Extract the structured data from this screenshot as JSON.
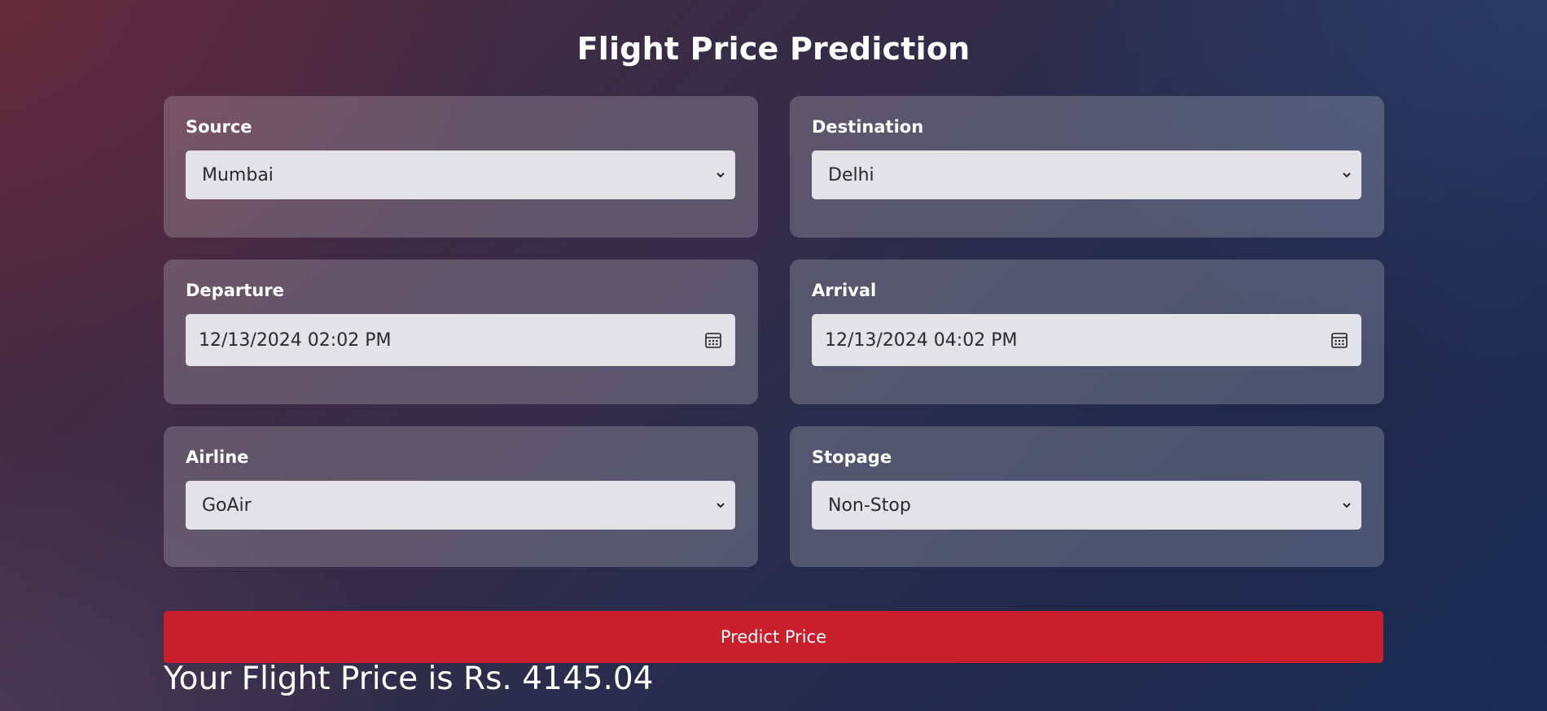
{
  "page": {
    "title": "Flight Price Prediction"
  },
  "form": {
    "source": {
      "label": "Source",
      "value": "Mumbai"
    },
    "destination": {
      "label": "Destination",
      "value": "Delhi"
    },
    "departure": {
      "label": "Departure",
      "value": "12/13/2024 02:02 PM"
    },
    "arrival": {
      "label": "Arrival",
      "value": "12/13/2024 04:02 PM"
    },
    "airline": {
      "label": "Airline",
      "value": "GoAir"
    },
    "stopage": {
      "label": "Stopage",
      "value": "Non-Stop"
    }
  },
  "actions": {
    "predict_label": "Predict Price"
  },
  "result": {
    "text": "Your Flight Price is Rs. 4145.04"
  },
  "colors": {
    "button_red": "#c91f2d",
    "field_bg": "#e2e2e7",
    "text_white": "#ffffff"
  },
  "icons": {
    "select": "chevron-down-icon",
    "datetime": "calendar-icon"
  }
}
